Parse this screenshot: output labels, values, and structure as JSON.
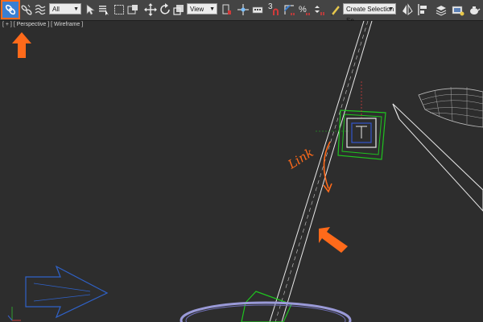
{
  "toolbar": {
    "selection_filter": "All",
    "reference_coord": "View",
    "snaps_toggle": "3",
    "named_selection_set": "Create Selection Se",
    "active_tool": "select-and-link"
  },
  "viewport": {
    "label_plus": "[ + ]",
    "label_view": "[ Perspective ]",
    "label_shading": "[ Wireframe ]",
    "annotation": "Link"
  },
  "colors": {
    "accent_orange": "#ff6a1a",
    "active_blue": "#3a7fd2",
    "selection_green": "#1fc41f",
    "wire_white": "#e8e8e8",
    "helper_blue": "#2f62c9",
    "ring_lavender": "#9a9ad8"
  }
}
